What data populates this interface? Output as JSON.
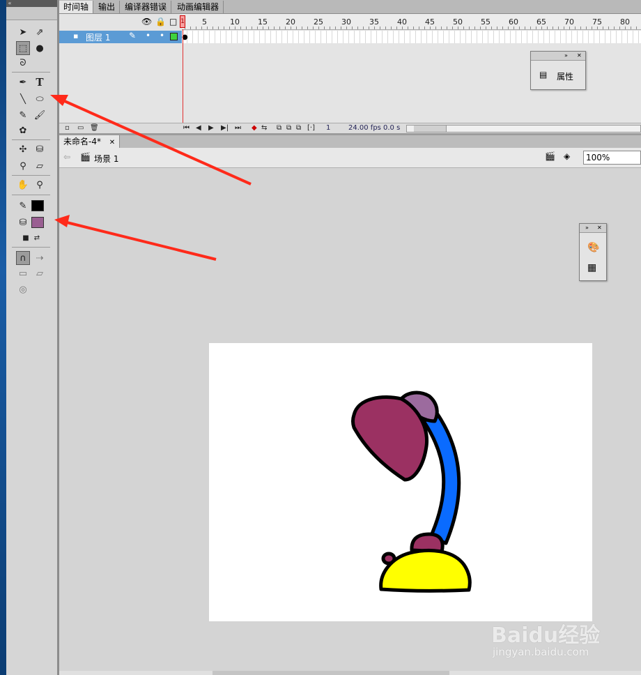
{
  "panel_tabs": [
    "时间轴",
    "输出",
    "编译器错误",
    "动画编辑器"
  ],
  "timeline": {
    "layer_name": "图层 1",
    "frame_marker": "1",
    "ruler_numbers": [
      "5",
      "10",
      "15",
      "20",
      "25",
      "30",
      "35",
      "40",
      "45",
      "50",
      "55",
      "60",
      "65",
      "70",
      "75",
      "80"
    ],
    "current_frame": "1",
    "fps": "24.00 fps",
    "time": "0.0 s"
  },
  "properties_panel": {
    "label": "属性"
  },
  "document": {
    "tab_title": "未命名-4*",
    "scene_label": "场景 1",
    "zoom": "100%"
  },
  "colors": {
    "stroke": "#000000",
    "fill": "#9a5f92",
    "lamp_shade": "#9b3162",
    "lamp_joint": "#9c6b9e",
    "lamp_arm": "#0a6bff",
    "lamp_base": "#ffff00",
    "arrow": "#ff2a1a"
  },
  "tool_icons": [
    "selection-tool-icon",
    "subselection-tool-icon",
    "free-transform-tool-icon",
    "3d-rotation-tool-icon",
    "lasso-tool-icon",
    "pen-tool-icon",
    "text-tool-icon",
    "line-tool-icon",
    "oval-tool-icon",
    "pencil-tool-icon",
    "brush-tool-icon",
    "deco-tool-icon",
    "bone-tool-icon",
    "paint-bucket-tool-icon",
    "eyedropper-tool-icon",
    "eraser-tool-icon",
    "hand-tool-icon",
    "zoom-tool-icon"
  ],
  "watermark": {
    "text": "Baidu经验",
    "url": "jingyan.baidu.com"
  }
}
